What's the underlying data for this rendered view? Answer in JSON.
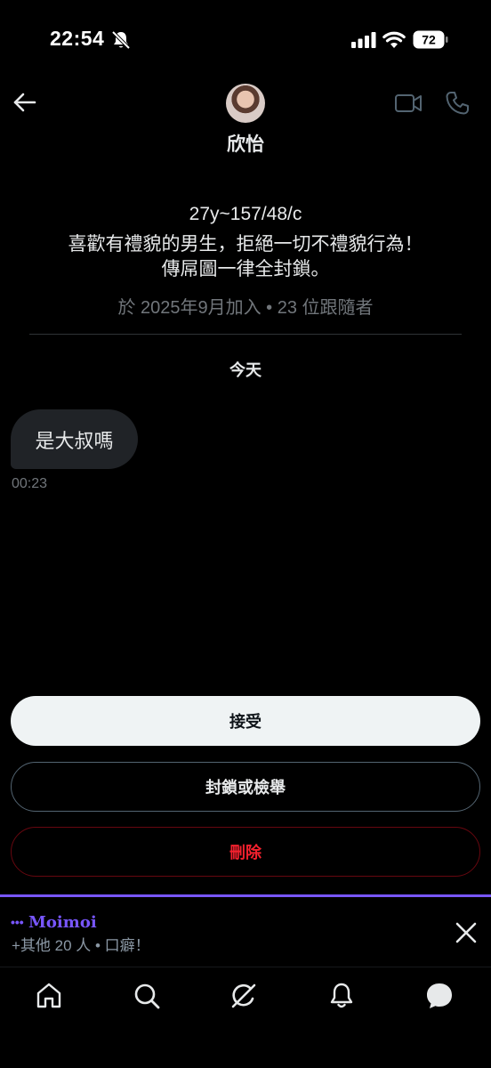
{
  "status_bar": {
    "time": "22:54",
    "battery": "72",
    "icons": [
      "bell-off-icon",
      "signal-icon",
      "wifi-icon",
      "battery-icon"
    ]
  },
  "header": {
    "name": "欣怡",
    "icons": [
      "back-arrow-icon",
      "avatar",
      "video-call-icon",
      "phone-call-icon"
    ]
  },
  "profile": {
    "bio_lines": [
      "27y~157/48/c",
      "喜歡有禮貌的男生，拒絕一切不禮貌行為！",
      "傳屌圖一律全封鎖。"
    ],
    "joined": "於 2025年9月加入 • 23 位跟隨者"
  },
  "conversation": {
    "date_separator": "今天",
    "messages": [
      {
        "text": "是大叔嗎",
        "time": "00:23"
      }
    ]
  },
  "actions": {
    "accept": "接受",
    "block_or_report": "封鎖或檢舉",
    "delete": "刪除"
  },
  "moimoi": {
    "dots": "•••",
    "name": "Moimoi",
    "subtitle": "+其他 20 人 • 口癖！"
  },
  "nav": {
    "items": [
      "home-icon",
      "search-icon",
      "grok-icon",
      "notifications-icon",
      "messages-icon"
    ]
  },
  "colors": {
    "background": "#000000",
    "accent_purple": "#7856ff",
    "danger": "#f4212e",
    "bubble": "#202327",
    "muted": "#71767b"
  }
}
